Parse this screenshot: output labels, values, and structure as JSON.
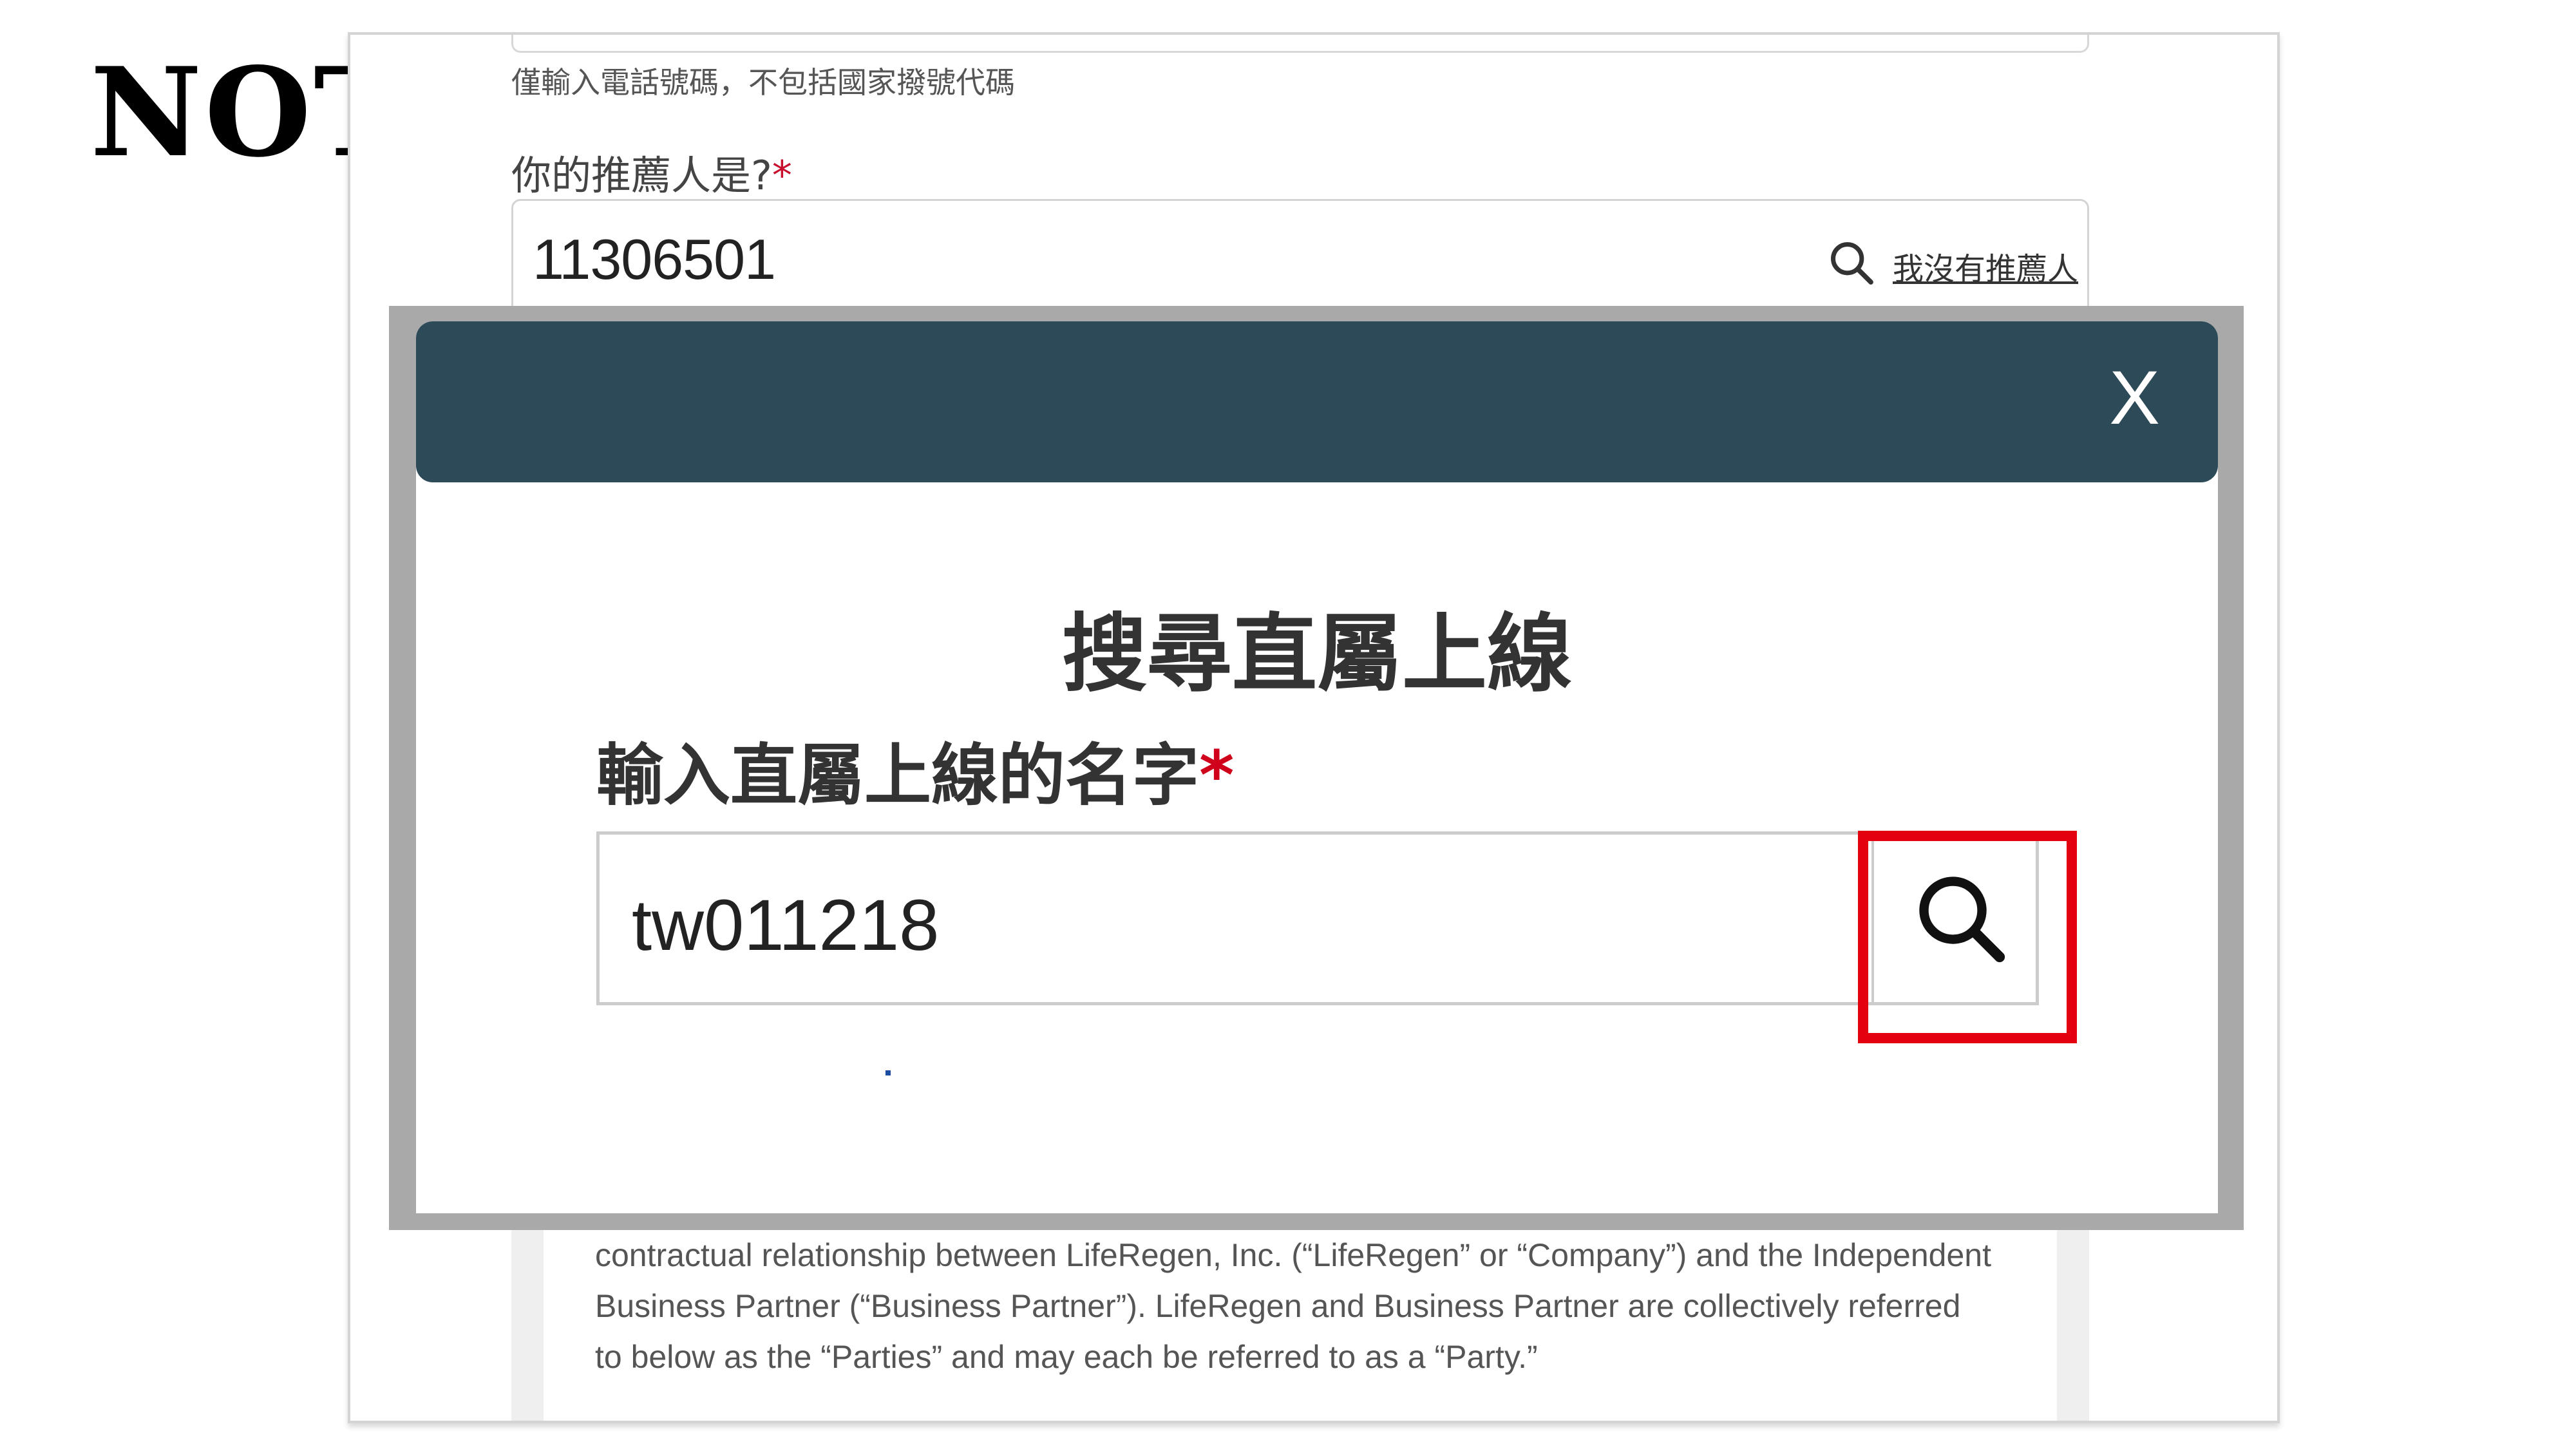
{
  "note_title": "NOTE.",
  "form": {
    "phone_hint": "僅輸入電話號碼，不包括國家撥號代碼",
    "referrer_label": "你的推薦人是?",
    "required_mark": "*",
    "referrer_value": "11306501",
    "no_referrer_link": "我沒有推薦人"
  },
  "contract": {
    "lines": [
      "contractual relationship between LifeRegen, Inc. (“LifeRegen” or “Company”) and the Independent",
      "Business Partner (“Business Partner”). LifeRegen and Business Partner are collectively referred",
      "to below as the “Parties” and may each be referred to as a “Party.”"
    ]
  },
  "modal": {
    "close_label": "X",
    "title": "搜尋直屬上線",
    "field_label": "輸入直屬上線的名字",
    "required_mark": "*",
    "input_value": "tw011218",
    "search_icon": "search-icon"
  },
  "colors": {
    "modal_header": "#2c4a57",
    "highlight": "#e3000f",
    "required": "#d0021b"
  }
}
